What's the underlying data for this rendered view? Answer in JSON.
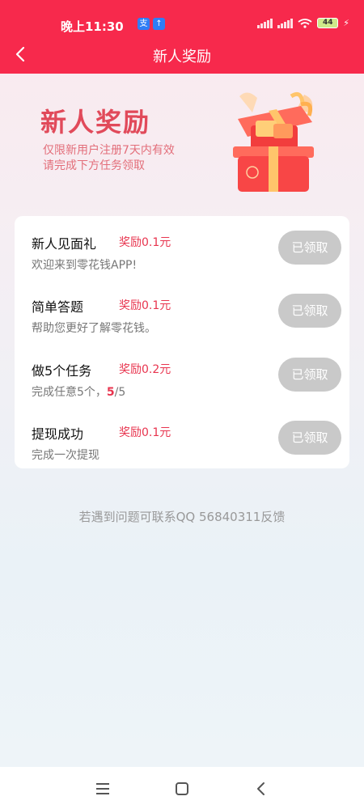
{
  "status_bar": {
    "time": "晚上11:30",
    "battery": "44"
  },
  "header": {
    "title": "新人奖励"
  },
  "banner": {
    "title": "新人奖励",
    "subtitle_line1": "仅限新用户注册7天内有效",
    "subtitle_line2": "请完成下方任务领取"
  },
  "tasks": [
    {
      "name": "新人见面礼",
      "reward": "奖励0.1元",
      "desc": "欢迎来到零花钱APP!",
      "button": "已领取"
    },
    {
      "name": "简单答题",
      "reward": "奖励0.1元",
      "desc": "帮助您更好了解零花钱。",
      "button": "已领取"
    },
    {
      "name": "做5个任务",
      "reward": "奖励0.2元",
      "desc_prefix": "完成任意5个，",
      "desc_progress": "5",
      "desc_suffix": "/5",
      "button": "已领取"
    },
    {
      "name": "提现成功",
      "reward": "奖励0.1元",
      "desc": "完成一次提现",
      "button": "已领取"
    }
  ],
  "footer": {
    "note": "若遇到问题可联系QQ 56840311反馈"
  },
  "colors": {
    "primary": "#f7294c",
    "reward": "#e8354f",
    "disabled_button": "#c9c9c9"
  },
  "icons": {
    "back": "chevron-left-icon",
    "gift": "gift-box-icon",
    "sys_menu": "menu-icon",
    "sys_home": "home-square-icon",
    "sys_back": "back-triangle-icon"
  }
}
